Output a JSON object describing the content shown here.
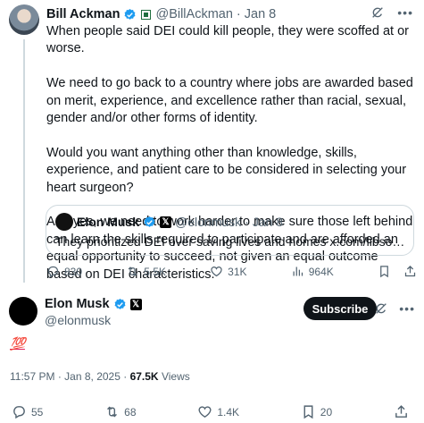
{
  "parent": {
    "name": "Bill Ackman",
    "handle": "@BillAckman",
    "separator": "·",
    "date": "Jan 8",
    "paragraphs": [
      "When people said DEI could kill people, they were scoffed at or worse.",
      "We need to go back to a country where jobs are awarded based on merit, experience, and excellence rather than racial, sexual, gender and/or other forms of identity.",
      "Would you want anything other than knowledge, skills, experience, and patient care to be considered in selecting your heart surgeon?",
      "And yes, we need to work harder to make sure those left behind can learn the skills required to participate and are afforded an equal opportunity to succeed, not given an equal outcome based on DEI characteristics."
    ],
    "quote": {
      "name": "Elon Musk",
      "handle": "@elonmusk",
      "separator": "·",
      "date": "Jan 8",
      "text": "They prioritized DEI over saving lives and homes x.com/libsoftiktok/s..."
    },
    "actions": {
      "replies": "830",
      "reposts": "5.5K",
      "likes": "31K",
      "views": "964K"
    }
  },
  "main": {
    "name": "Elon Musk",
    "handle": "@elonmusk",
    "subscribe_label": "Subscribe",
    "text": "💯",
    "time": "11:57 PM",
    "separator": "·",
    "date": "Jan 8, 2025",
    "meta_separator": "·",
    "views_count": "67.5K",
    "views_label": "Views",
    "actions": {
      "replies": "55",
      "reposts": "68",
      "likes": "1.4K",
      "bookmarks": "20"
    }
  },
  "icons": {
    "verified": "verified-badge-icon",
    "grok": "grok-icon",
    "more": "more-icon",
    "reply": "reply-icon",
    "repost": "repost-icon",
    "like": "heart-icon",
    "views": "views-icon",
    "bookmark": "bookmark-icon",
    "share": "share-icon"
  },
  "colors": {
    "verified": "#1d9bf0",
    "text": "#0f1419",
    "muted": "#536471",
    "border": "#cfd9de"
  }
}
